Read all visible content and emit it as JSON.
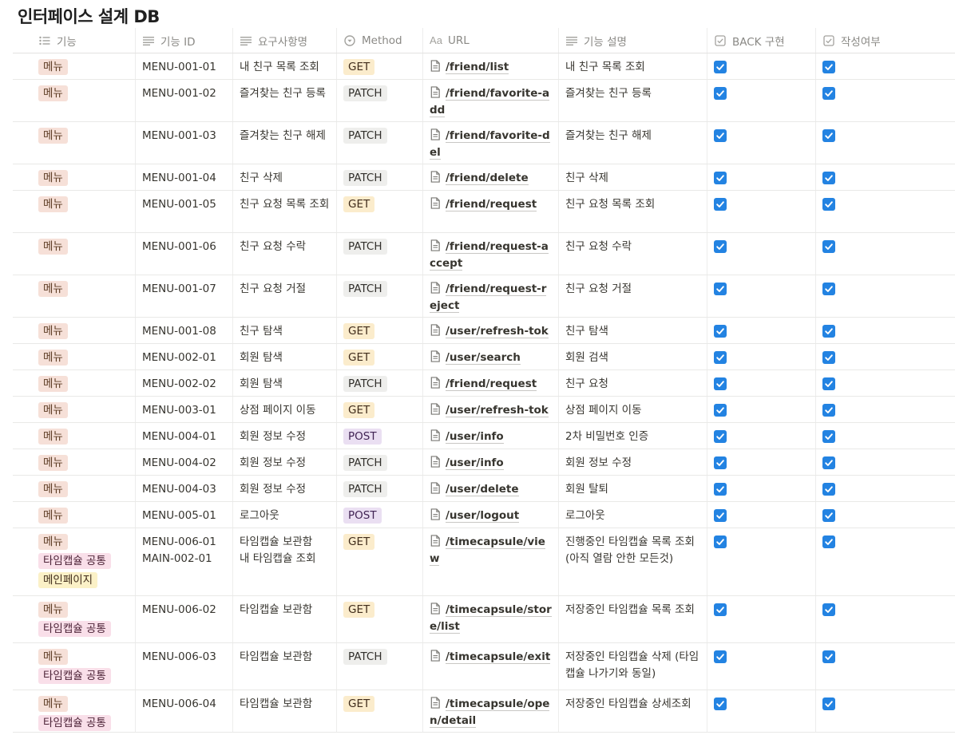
{
  "title": "인터페이스 설계 DB",
  "columns": [
    {
      "label": "기능",
      "icon": "list-icon"
    },
    {
      "label": "기능 ID",
      "icon": "text-icon"
    },
    {
      "label": "요구사항명",
      "icon": "text-icon"
    },
    {
      "label": "Method",
      "icon": "select-icon"
    },
    {
      "label": "URL",
      "icon": "title-icon"
    },
    {
      "label": "기능 설명",
      "icon": "text-icon"
    },
    {
      "label": "BACK 구현",
      "icon": "checkbox-icon"
    },
    {
      "label": "작성여부",
      "icon": "checkbox-icon"
    }
  ],
  "colors": {
    "checkbox": "#2383e2",
    "tag_menu": "#f6e0d8",
    "tag_timecapsule": "#f9dfe9",
    "tag_main": "#fbf1c7",
    "get": "#fbeccc",
    "patch": "#eeeeec",
    "post": "#eadff2"
  },
  "rows": [
    {
      "tags": [
        "메뉴"
      ],
      "id": "MENU-001-01",
      "req": "내 친구 목록 조회",
      "method": "GET",
      "url": "/friend/list",
      "desc": "내 친구 목록 조회",
      "back": true,
      "written": true
    },
    {
      "tags": [
        "메뉴"
      ],
      "id": "MENU-001-02",
      "req": "즐겨찾는 친구 등록",
      "method": "PATCH",
      "url": "/friend/favorite-add",
      "desc": "즐겨찾는 친구 등록",
      "back": true,
      "written": true
    },
    {
      "tags": [
        "메뉴"
      ],
      "id": "MENU-001-03",
      "req": "즐겨찾는 친구 해제",
      "method": "PATCH",
      "url": "/friend/favorite-del",
      "desc": "즐겨찾는 친구 해제",
      "back": true,
      "written": true
    },
    {
      "tags": [
        "메뉴"
      ],
      "id": "MENU-001-04",
      "req": "친구 삭제",
      "method": "PATCH",
      "url": "/friend/delete",
      "desc": "친구 삭제",
      "back": true,
      "written": true
    },
    {
      "tags": [
        "메뉴"
      ],
      "id": "MENU-001-05",
      "req": "친구 요청 목록 조회",
      "method": "GET",
      "url": "/friend/request",
      "desc": "친구 요청 목록 조회",
      "back": true,
      "written": true
    },
    {
      "tags": [
        "메뉴"
      ],
      "id": "MENU-001-06",
      "req": "친구 요청 수락",
      "method": "PATCH",
      "url": "/friend/request-accept",
      "desc": "친구 요청 수락",
      "back": true,
      "written": true
    },
    {
      "tags": [
        "메뉴"
      ],
      "id": "MENU-001-07",
      "req": "친구 요청 거절",
      "method": "PATCH",
      "url": "/friend/request-reject",
      "desc": "친구 요청 거절",
      "back": true,
      "written": true
    },
    {
      "tags": [
        "메뉴"
      ],
      "id": "MENU-001-08",
      "req": "친구 탐색",
      "method": "GET",
      "url": "/user/refresh-token",
      "desc": "친구 탐색",
      "back": true,
      "written": true
    },
    {
      "tags": [
        "메뉴"
      ],
      "id": "MENU-002-01",
      "req": "회원 탐색",
      "method": "GET",
      "url": "/user/search",
      "desc": "회원 검색",
      "back": true,
      "written": true
    },
    {
      "tags": [
        "메뉴"
      ],
      "id": "MENU-002-02",
      "req": "회원 탐색",
      "method": "PATCH",
      "url": "/friend/request",
      "desc": "친구 요청",
      "back": true,
      "written": true
    },
    {
      "tags": [
        "메뉴"
      ],
      "id": "MENU-003-01",
      "req": "상점 페이지 이동",
      "method": "GET",
      "url": "/user/refresh-token",
      "desc": "상점 페이지 이동",
      "back": true,
      "written": true
    },
    {
      "tags": [
        "메뉴"
      ],
      "id": "MENU-004-01",
      "req": "회원 정보 수정",
      "method": "POST",
      "url": "/user/info",
      "desc": "2차 비밀번호 인증",
      "back": true,
      "written": true
    },
    {
      "tags": [
        "메뉴"
      ],
      "id": "MENU-004-02",
      "req": "회원 정보 수정",
      "method": "PATCH",
      "url": "/user/info",
      "desc": "회원 정보 수정",
      "back": true,
      "written": true
    },
    {
      "tags": [
        "메뉴"
      ],
      "id": "MENU-004-03",
      "req": "회원 정보 수정",
      "method": "PATCH",
      "url": "/user/delete",
      "desc": "회원 탈퇴",
      "back": true,
      "written": true
    },
    {
      "tags": [
        "메뉴"
      ],
      "id": "MENU-005-01",
      "req": "로그아웃",
      "method": "POST",
      "url": "/user/logout",
      "desc": "로그아웃",
      "back": true,
      "written": true
    },
    {
      "tags": [
        "메뉴",
        "타임캡슐 공통",
        "메인페이지"
      ],
      "id": "MENU-006-01\nMAIN-002-01",
      "req": "타임캡슐 보관함\n내 타임캡슐 조회",
      "method": "GET",
      "url": "/timecapsule/view",
      "desc": "진행중인 타임캡슐 목록 조회 (아직 열람 안한 모든것)",
      "back": true,
      "written": true
    },
    {
      "tags": [
        "메뉴",
        "타임캡슐 공통"
      ],
      "id": "MENU-006-02",
      "req": "타임캡슐 보관함",
      "method": "GET",
      "url": "/timecapsule/store/list",
      "desc": "저장중인 타임캡슐 목록 조회",
      "back": true,
      "written": true
    },
    {
      "tags": [
        "메뉴",
        "타임캡슐 공통"
      ],
      "id": "MENU-006-03",
      "req": "타임캡슐 보관함",
      "method": "PATCH",
      "url": "/timecapsule/exit",
      "desc": "저장중인 타임캡슐 삭제 (타임캡슐 나가기와 동일)",
      "back": true,
      "written": true
    },
    {
      "tags": [
        "메뉴",
        "타임캡슐 공통"
      ],
      "id": "MENU-006-04",
      "req": "타임캡슐 보관함",
      "method": "GET",
      "url": "/timecapsule/open/detail",
      "desc": "저장중인 타임캡슐 상세조회",
      "back": true,
      "written": true
    }
  ]
}
